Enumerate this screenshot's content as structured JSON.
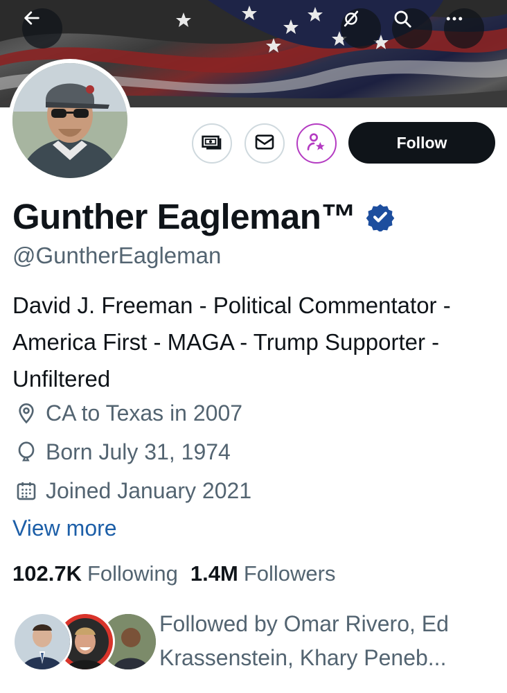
{
  "header": {
    "back_icon": "arrow-left-icon",
    "notifications_icon": "bell-off-icon",
    "search_icon": "search-icon",
    "more_icon": "more-horizontal-icon"
  },
  "profile": {
    "display_name": "Gunther Eagleman™",
    "handle": "@GuntherEagleman",
    "verified": true,
    "bio": "David J. Freeman - Political Commentator - America First - MAGA - Trump Supporter - Unfiltered",
    "location": "CA to Texas in 2007",
    "birthday": "Born July 31, 1974",
    "joined": "Joined January 2021",
    "view_more": "View more"
  },
  "actions": {
    "tip_icon": "money-icon",
    "message_icon": "envelope-icon",
    "subscribe_icon": "person-star-icon",
    "follow_label": "Follow"
  },
  "stats": {
    "following_count": "102.7K",
    "following_label": "Following",
    "followers_count": "1.4M",
    "followers_label": "Followers"
  },
  "followed_by": {
    "text": "Followed by Omar Rivero, Ed Krassenstein, Khary Peneb..."
  },
  "colors": {
    "accent_link": "#1d5fa8",
    "verified_blue": "#1d4e9e",
    "subscribe_purple": "#b43bc2",
    "follow_button": "#0f1419"
  }
}
